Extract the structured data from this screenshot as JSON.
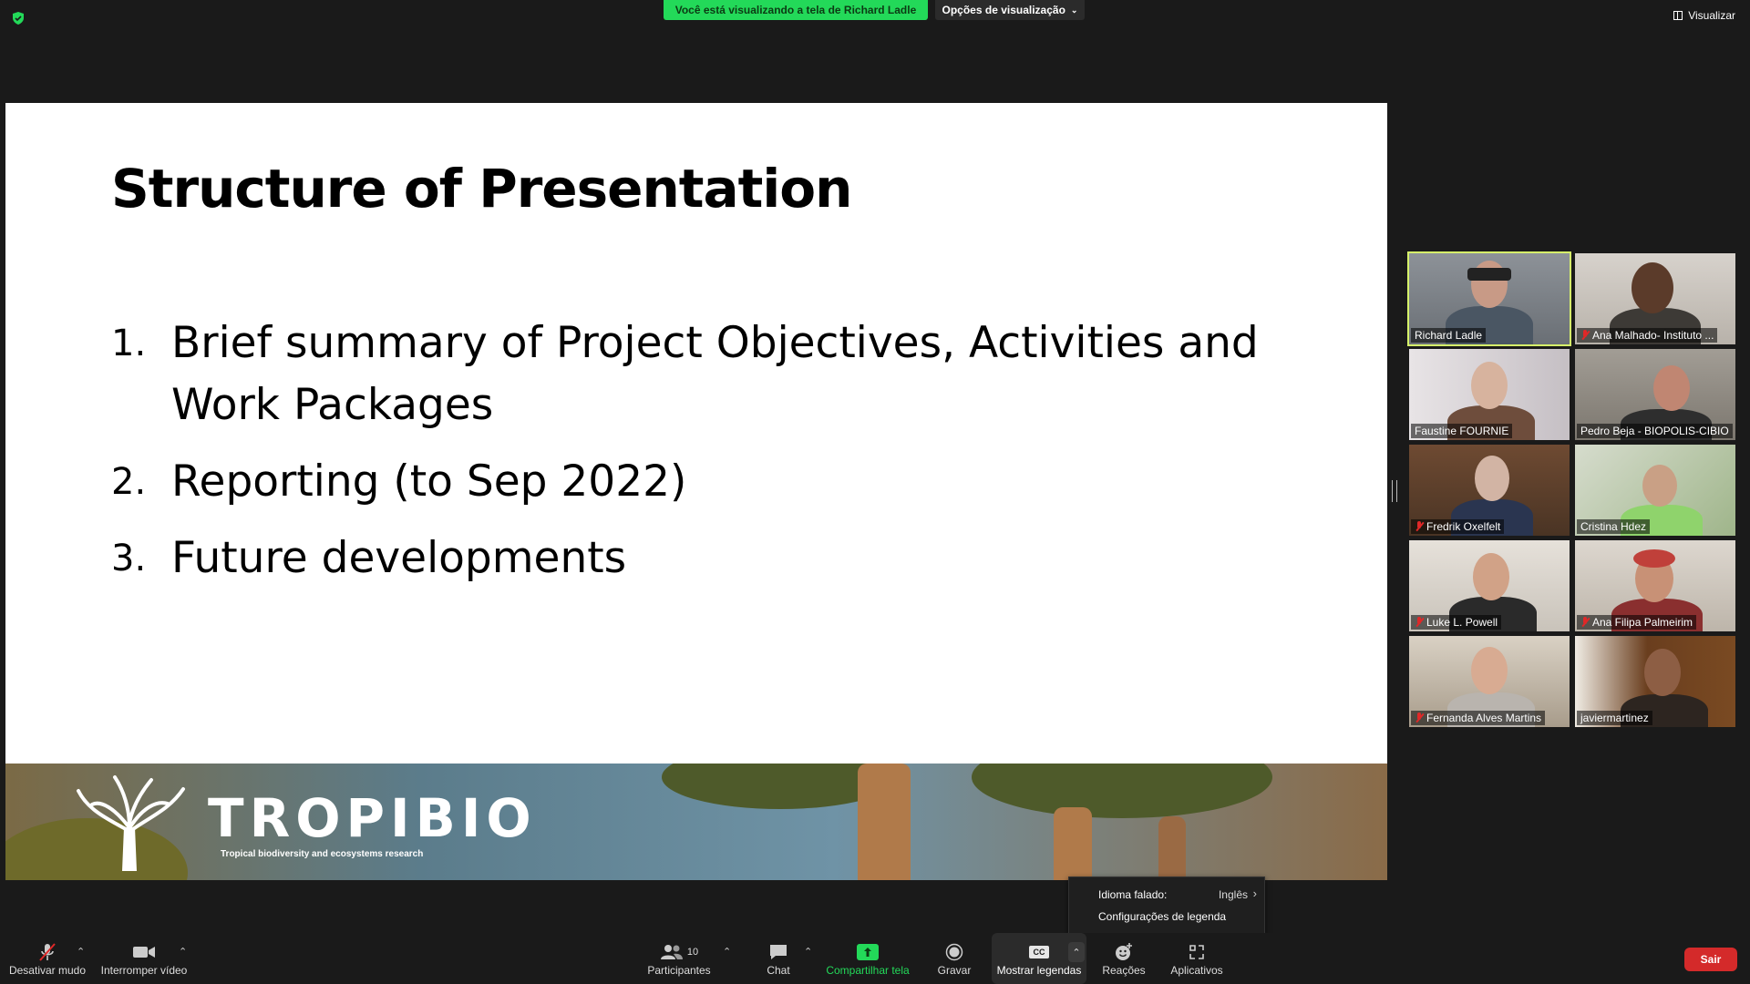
{
  "topbar": {
    "viewing_banner": "Você está visualizando a tela de Richard Ladle",
    "view_options": "Opções de visualização",
    "view_button": "Visualizar"
  },
  "slide": {
    "title": "Structure of Presentation",
    "items": [
      {
        "num": "1.",
        "text": "Brief summary of Project Objectives, Activities and Work Packages"
      },
      {
        "num": "2.",
        "text": "Reporting (to Sep 2022)"
      },
      {
        "num": "3.",
        "text": "Future developments"
      }
    ],
    "logo_text": "TROPIBIO",
    "logo_subtitle": "Tropical biodiversity and ecosystems research"
  },
  "participants": [
    {
      "name": "Richard Ladle",
      "muted": false,
      "active": true
    },
    {
      "name": "Ana Malhado- Instituto ...",
      "muted": true,
      "active": false
    },
    {
      "name": "Faustine FOURNIE",
      "muted": false,
      "active": false
    },
    {
      "name": "Pedro Beja - BIOPOLIS-CIBIO",
      "muted": false,
      "active": false
    },
    {
      "name": "Fredrik Oxelfelt",
      "muted": true,
      "active": false
    },
    {
      "name": "Cristina Hdez",
      "muted": false,
      "active": false
    },
    {
      "name": "Luke L. Powell",
      "muted": true,
      "active": false
    },
    {
      "name": "Ana Filipa Palmeirim",
      "muted": true,
      "active": false
    },
    {
      "name": "Fernanda Alves Martins",
      "muted": true,
      "active": false
    },
    {
      "name": "javiermartinez",
      "muted": false,
      "active": false
    }
  ],
  "caption_menu": {
    "spoken_language_label": "Idioma falado:",
    "spoken_language_value": "Inglês",
    "caption_settings": "Configurações de legenda"
  },
  "toolbar": {
    "mute": "Desativar mudo",
    "video": "Interromper vídeo",
    "participants": "Participantes",
    "participants_count": "10",
    "chat": "Chat",
    "share": "Compartilhar tela",
    "record": "Gravar",
    "captions": "Mostrar legendas",
    "cc": "CC",
    "reactions": "Reações",
    "apps": "Aplicativos",
    "exit": "Sair"
  }
}
